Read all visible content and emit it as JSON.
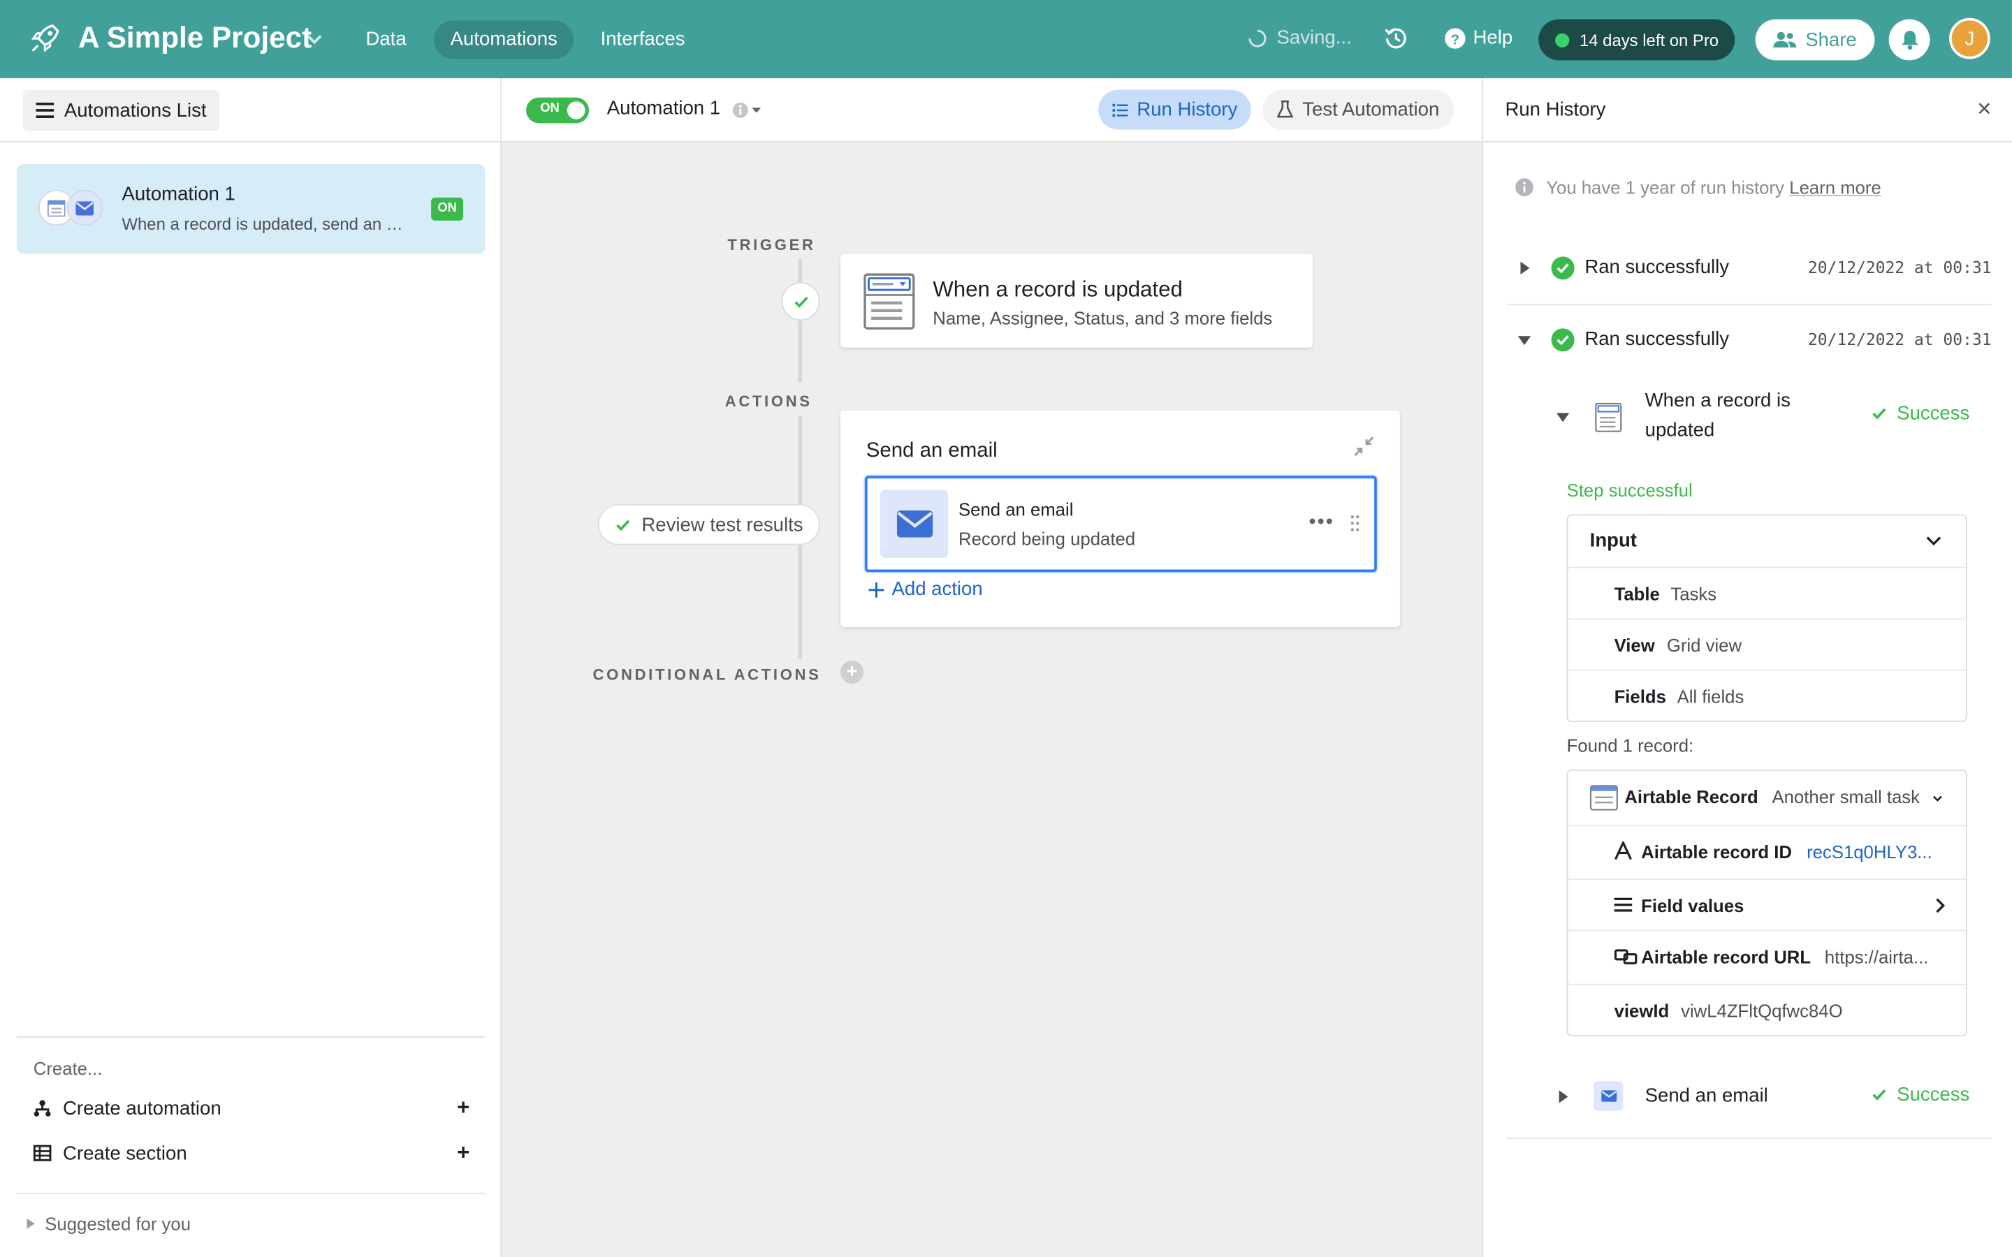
{
  "topbar": {
    "project_name": "A Simple Project",
    "nav": [
      "Data",
      "Automations",
      "Interfaces"
    ],
    "active_nav": "Automations",
    "saving": "Saving...",
    "help": "Help",
    "pro": "14 days left on Pro",
    "share": "Share",
    "avatar_initial": "J"
  },
  "sidebar": {
    "list_button": "Automations List",
    "automation": {
      "title": "Automation 1",
      "desc": "When a record is updated, send an email",
      "badge": "ON"
    },
    "create_label": "Create...",
    "create_automation": "Create automation",
    "create_section": "Create section",
    "suggested": "Suggested for you"
  },
  "editor": {
    "toggle": "ON",
    "automation_name": "Automation 1",
    "run_history": "Run History",
    "test_automation": "Test Automation",
    "trigger_label": "TRIGGER",
    "actions_label": "ACTIONS",
    "conditional_label": "CONDITIONAL ACTIONS",
    "trigger_title": "When a record is updated",
    "trigger_sub": "Name, Assignee, Status, and 3 more fields",
    "review": "Review test results",
    "action_group_title": "Send an email",
    "action_title": "Send an email",
    "action_sub": "Record being updated",
    "add_action": "Add action"
  },
  "run_history": {
    "title": "Run History",
    "info": "You have 1 year of run history",
    "learn_more": "Learn more",
    "runs": [
      {
        "status": "Ran successfully",
        "timestamp": "20/12/2022 at 00:31"
      },
      {
        "status": "Ran successfully",
        "timestamp": "20/12/2022 at 00:31"
      }
    ],
    "trigger_step": {
      "title_line1": "When a record is",
      "title_line2": "updated",
      "status": "Success"
    },
    "step_successful": "Step successful",
    "input": {
      "header": "Input",
      "rows": [
        {
          "key": "Table",
          "value": "Tasks"
        },
        {
          "key": "View",
          "value": "Grid view"
        },
        {
          "key": "Fields",
          "value": "All fields"
        }
      ]
    },
    "found": "Found 1 record:",
    "record": {
      "key": "Airtable Record",
      "value": "Another small task",
      "id_key": "Airtable record ID",
      "id_value": "recS1q0HLY3...",
      "field_values": "Field values",
      "url_key": "Airtable record URL",
      "url_value": "https://airta...",
      "viewid_key": "viewId",
      "viewid_value": "viwL4ZFltQqfwc84O"
    },
    "email_step": {
      "title": "Send an email",
      "status": "Success"
    }
  },
  "colors": {
    "topbar": "#41a19a",
    "accent_blue": "#2d7ff9",
    "success_green": "#3cb94c"
  }
}
